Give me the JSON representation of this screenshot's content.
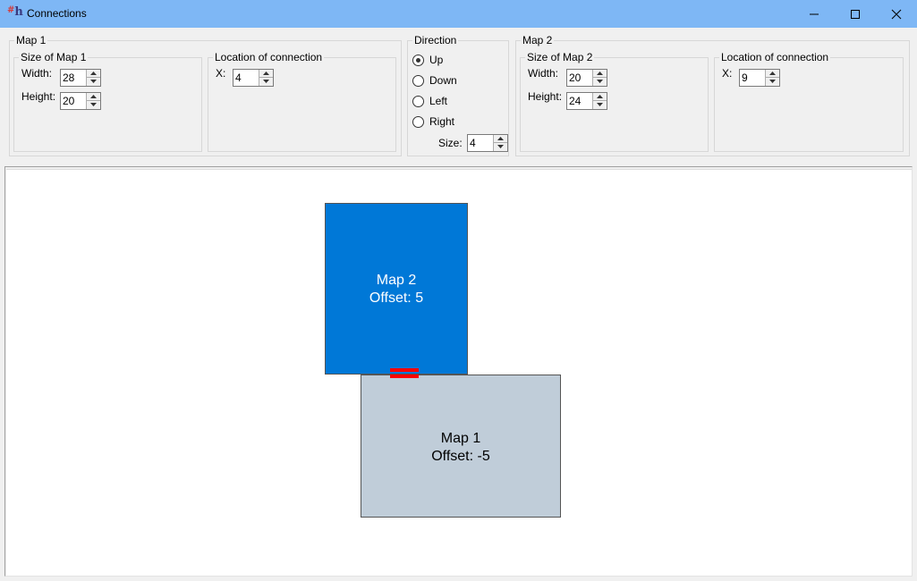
{
  "window": {
    "icon_glyph": "h",
    "icon_hash": "#",
    "title": "Connections",
    "icons": [
      "minimize-icon",
      "maximize-icon",
      "close-icon"
    ]
  },
  "map1_group": {
    "legend": "Map 1",
    "size": {
      "legend": "Size of Map 1",
      "width_label": "Width:",
      "width_value": "28",
      "height_label": "Height:",
      "height_value": "20"
    },
    "location": {
      "legend": "Location of connection",
      "x_label": "X:",
      "x_value": "4"
    }
  },
  "direction_group": {
    "legend": "Direction",
    "options": [
      {
        "label": "Up",
        "selected": true
      },
      {
        "label": "Down",
        "selected": false
      },
      {
        "label": "Left",
        "selected": false
      },
      {
        "label": "Right",
        "selected": false
      }
    ],
    "size_label": "Size:",
    "size_value": "4"
  },
  "map2_group": {
    "legend": "Map 2",
    "size": {
      "legend": "Size of Map 2",
      "width_label": "Width:",
      "width_value": "20",
      "height_label": "Height:",
      "height_value": "24"
    },
    "location": {
      "legend": "Location of connection",
      "x_label": "X:",
      "x_value": "9"
    }
  },
  "canvas": {
    "map2": {
      "name": "Map 2",
      "offset": "Offset: 5",
      "color": "#0078d7"
    },
    "map1": {
      "name": "Map 1",
      "offset": "Offset: -5",
      "color": "#c0cdd9"
    },
    "connection_color": "#ff0000"
  }
}
